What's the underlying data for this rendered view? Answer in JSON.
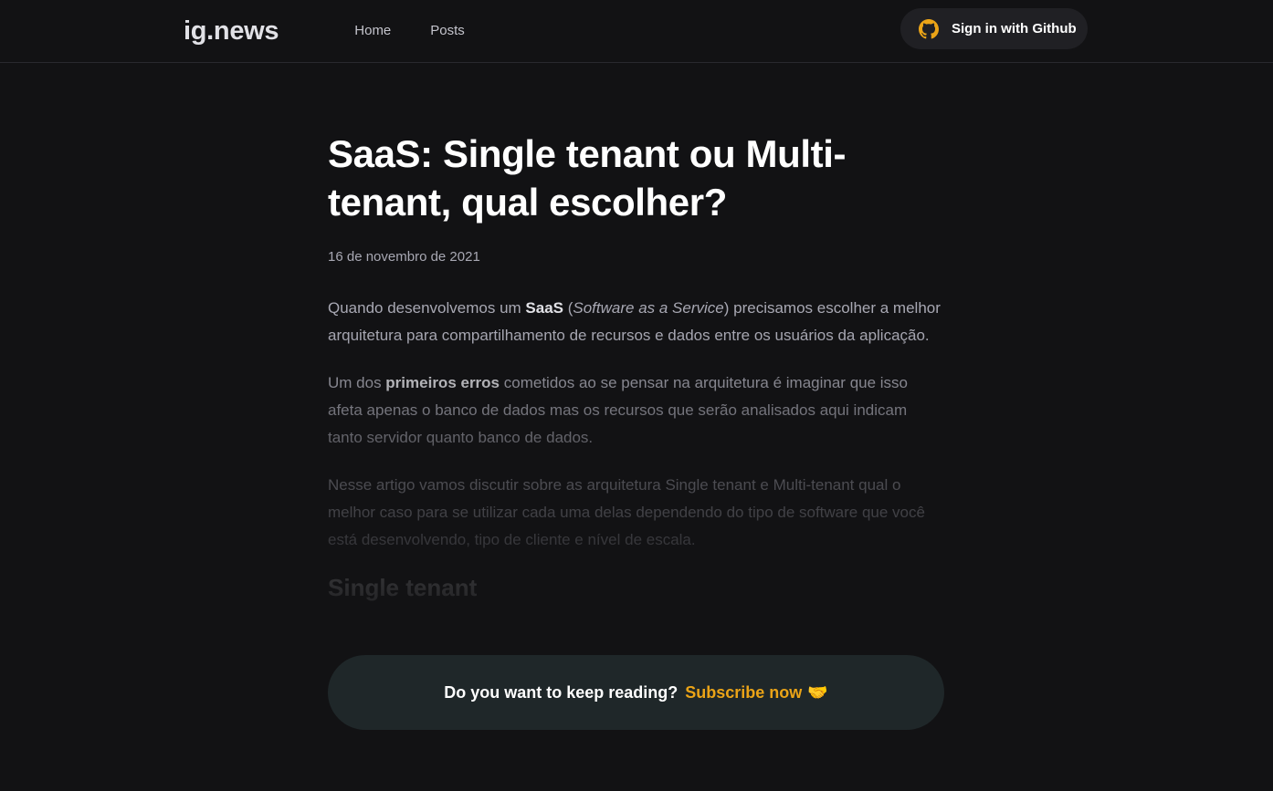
{
  "header": {
    "logo": "ig.news",
    "nav": [
      {
        "label": "Home"
      },
      {
        "label": "Posts"
      }
    ],
    "signin_label": "Sign in with Github",
    "github_icon_color": "#eba417"
  },
  "article": {
    "title": "SaaS: Single tenant ou Multi-tenant, qual escolher?",
    "date": "16 de novembro de 2021",
    "p1": {
      "a": "Quando desenvolvemos um ",
      "b": "SaaS",
      "c": " (",
      "d": "Software as a Service",
      "e": ") precisamos escolher a melhor arquitetura para compartilhamento de recursos e dados entre os usuários da aplicação."
    },
    "p2": {
      "a": "Um dos ",
      "b": "primeiros erros",
      "c": " cometidos ao se pensar na arquitetura é imaginar que isso afeta apenas o banco de dados mas os recursos que serão analisados aqui indicam tanto servidor quanto banco de dados."
    },
    "p3": "Nesse artigo vamos discutir sobre as arquitetura Single tenant e Multi-tenant qual o melhor caso para se utilizar cada uma delas dependendo do tipo de software que você está desenvolvendo, tipo de cliente e nível de escala.",
    "h2": "Single tenant"
  },
  "cta": {
    "question": "Do you want to keep reading?",
    "link": "Subscribe now",
    "emoji": "🤝"
  },
  "colors": {
    "background": "#121214",
    "accent": "#eba417",
    "card": "#1f2729"
  }
}
